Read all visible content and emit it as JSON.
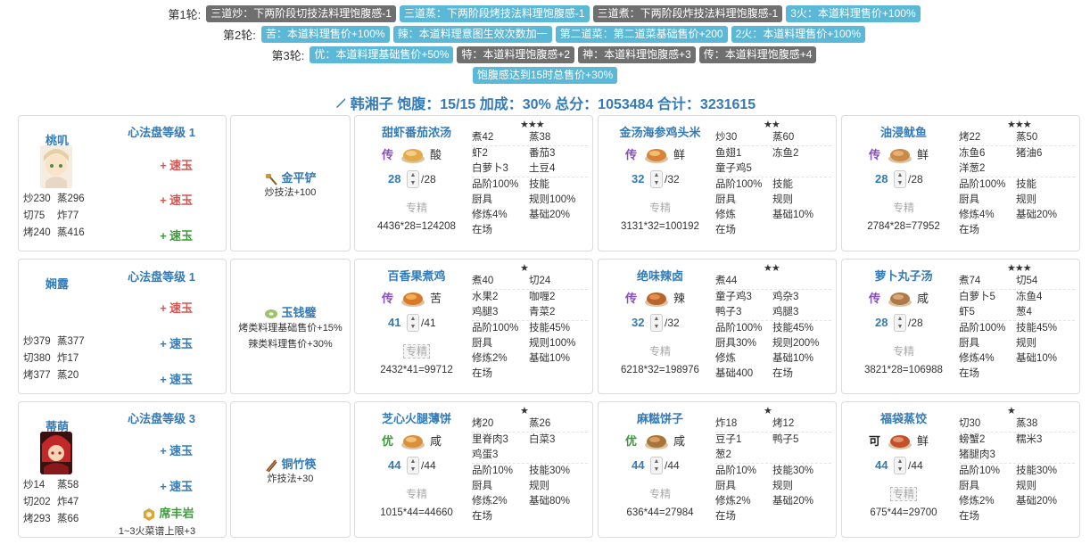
{
  "rounds": [
    {
      "label": "第1轮:",
      "tags": [
        {
          "text": "三道炒：下两阶段切技法料理饱腹感-1",
          "color": "gray"
        },
        {
          "text": "三道蒸：下两阶段烤技法料理饱腹感-1",
          "color": "blue"
        },
        {
          "text": "三道煮：下两阶段炸技法料理饱腹感-1",
          "color": "gray"
        },
        {
          "text": "3火：本道料理售价+100%",
          "color": "blue"
        }
      ]
    },
    {
      "label": "第2轮:",
      "tags": [
        {
          "text": "苦：本道料理售价+100%",
          "color": "blue"
        },
        {
          "text": "辣：本道料理意图生效次数加一",
          "color": "blue"
        },
        {
          "text": "第二道菜：第二道菜基础售价+200",
          "color": "blue"
        },
        {
          "text": "2火：本道料理售价+100%",
          "color": "blue"
        }
      ]
    },
    {
      "label": "第3轮:",
      "tags": [
        {
          "text": "优：本道料理基础售价+50%",
          "color": "blue"
        },
        {
          "text": "特：本道料理饱腹感+2",
          "color": "gray"
        },
        {
          "text": "神：本道料理饱腹感+3",
          "color": "gray"
        },
        {
          "text": "传：本道料理饱腹感+4",
          "color": "gray"
        }
      ]
    },
    {
      "label": "",
      "tags": [
        {
          "text": "饱腹感达到15时总售价+30%",
          "color": "blue"
        }
      ]
    }
  ],
  "summary": {
    "icon": "knife-icon",
    "text": "韩湘子 饱腹：15/15 加成：30% 总分：1053484 合计：3231615"
  },
  "chefs": [
    {
      "name": "桃叽",
      "level": "心法盘等级 1",
      "stats": [
        [
          "炒230",
          "蒸296"
        ],
        [
          "切75",
          "炸77"
        ],
        [
          "烤240",
          "蒸416"
        ]
      ],
      "jades": [
        {
          "sign": "+",
          "text": "速玉",
          "color": "red"
        },
        {
          "sign": "+",
          "text": "速玉",
          "color": "red"
        },
        {
          "sign": "+",
          "text": "速玉",
          "color": "green"
        }
      ]
    },
    {
      "name": "娴露",
      "level": "心法盘等级 1",
      "stats": [
        [
          "炒379",
          "蒸377"
        ],
        [
          "切380",
          "炸17"
        ],
        [
          "烤377",
          "蒸20"
        ]
      ],
      "jades": [
        {
          "sign": "+",
          "text": "速玉",
          "color": "red"
        },
        {
          "sign": "+",
          "text": "速玉",
          "color": "blue"
        },
        {
          "sign": "+",
          "text": "速玉",
          "color": "blue"
        }
      ]
    },
    {
      "name": "蒂萌",
      "level": "心法盘等级 3",
      "stats": [
        [
          "炒14",
          "蒸58"
        ],
        [
          "切202",
          "炸47"
        ],
        [
          "烤293",
          "蒸66"
        ]
      ],
      "jades": [
        {
          "sign": "+",
          "text": "速玉",
          "color": "blue"
        },
        {
          "sign": "+",
          "text": "速玉",
          "color": "blue"
        }
      ],
      "aide": "席丰岩",
      "aide_note": "1~3火菜谱上限+3"
    }
  ],
  "equips": [
    {
      "name": "金平铲",
      "effects": [
        "炒技法+100"
      ]
    },
    {
      "name": "玉钱璧",
      "effects": [
        "烤类料理基础售价+15%",
        "辣类料理售价+30%"
      ]
    },
    {
      "name": "铜竹筷",
      "effects": [
        "炸技法+30"
      ]
    }
  ],
  "recipes": [
    [
      {
        "name": "甜虾番茄浓汤",
        "stars": "★★★",
        "rank": "传",
        "rank_color": "purple",
        "flavor": "酸",
        "qty": "28",
        "max": "/28",
        "skill": "专精",
        "skill_boxed": false,
        "total": "4436*28=124208",
        "rows": [
          [
            "煮42",
            "蒸38"
          ],
          [
            "虾2",
            "番茄3"
          ],
          [
            "白萝卜3",
            "土豆4"
          ],
          [
            "品阶100%",
            "技能"
          ],
          [
            "厨具",
            "规则100%"
          ],
          [
            "修炼4%",
            "基础20%"
          ],
          [
            "在场",
            ""
          ]
        ]
      },
      {
        "name": "金汤海参鸡头米",
        "stars": "★★",
        "rank": "传",
        "rank_color": "purple",
        "flavor": "鲜",
        "qty": "32",
        "max": "/32",
        "skill": "专精",
        "skill_boxed": false,
        "total": "3131*32=100192",
        "rows": [
          [
            "炒30",
            "蒸60"
          ],
          [
            "鱼翅1",
            "冻鱼2"
          ],
          [
            "童子鸡5",
            ""
          ],
          [
            "品阶100%",
            "技能"
          ],
          [
            "厨具",
            "规则"
          ],
          [
            "修炼",
            "基础10%"
          ],
          [
            "在场",
            ""
          ]
        ]
      },
      {
        "name": "油浸鱿鱼",
        "stars": "★★★",
        "rank": "传",
        "rank_color": "purple",
        "flavor": "鲜",
        "qty": "28",
        "max": "/28",
        "skill": "专精",
        "skill_boxed": false,
        "total": "2784*28=77952",
        "rows": [
          [
            "烤22",
            "蒸50"
          ],
          [
            "冻鱼6",
            "猪油6"
          ],
          [
            "洋葱2",
            ""
          ],
          [
            "品阶100%",
            "技能"
          ],
          [
            "厨具",
            "规则"
          ],
          [
            "修炼4%",
            "基础20%"
          ],
          [
            "在场",
            ""
          ]
        ]
      }
    ],
    [
      {
        "name": "百香果煮鸡",
        "stars": "★",
        "rank": "传",
        "rank_color": "purple",
        "flavor": "苦",
        "qty": "41",
        "max": "/41",
        "skill": "专精",
        "skill_boxed": true,
        "total": "2432*41=99712",
        "rows": [
          [
            "煮40",
            "切24"
          ],
          [
            "水果2",
            "咖喱2"
          ],
          [
            "鸡腿3",
            "青菜2"
          ],
          [
            "品阶100%",
            "技能45%"
          ],
          [
            "厨具",
            "规则100%"
          ],
          [
            "修炼2%",
            "基础10%"
          ],
          [
            "在场",
            ""
          ]
        ]
      },
      {
        "name": "绝味辣卤",
        "stars": "★★",
        "rank": "传",
        "rank_color": "purple",
        "flavor": "辣",
        "qty": "32",
        "max": "/32",
        "skill": "专精",
        "skill_boxed": false,
        "total": "6218*32=198976",
        "rows": [
          [
            "煮44",
            ""
          ],
          [
            "童子鸡3",
            "鸡杂3"
          ],
          [
            "鸭子3",
            "鸡腿3"
          ],
          [
            "品阶100%",
            "技能45%"
          ],
          [
            "厨具30%",
            "规则200%"
          ],
          [
            "修炼",
            "基础10%"
          ],
          [
            "基础400",
            "在场"
          ]
        ]
      },
      {
        "name": "萝卜丸子汤",
        "stars": "★★★",
        "rank": "传",
        "rank_color": "purple",
        "flavor": "咸",
        "qty": "28",
        "max": "/28",
        "skill": "专精",
        "skill_boxed": false,
        "total": "3821*28=106988",
        "rows": [
          [
            "煮74",
            "切54"
          ],
          [
            "白萝卜5",
            "冻鱼4"
          ],
          [
            "虾5",
            "葱4"
          ],
          [
            "品阶100%",
            "技能45%"
          ],
          [
            "厨具",
            "规则"
          ],
          [
            "修炼4%",
            "基础10%"
          ],
          [
            "在场",
            ""
          ]
        ]
      }
    ],
    [
      {
        "name": "芝心火腿薄饼",
        "stars": "★",
        "rank": "优",
        "rank_color": "green",
        "flavor": "咸",
        "qty": "44",
        "max": "/44",
        "skill": "专精",
        "skill_boxed": false,
        "total": "1015*44=44660",
        "rows": [
          [
            "烤20",
            "蒸26"
          ],
          [
            "里脊肉3",
            "白菜3"
          ],
          [
            "鸡蛋3",
            ""
          ],
          [
            "品阶10%",
            "技能30%"
          ],
          [
            "厨具",
            "规则"
          ],
          [
            "修炼2%",
            "基础80%"
          ],
          [
            "在场",
            ""
          ]
        ]
      },
      {
        "name": "麻糍饼子",
        "stars": "★",
        "rank": "优",
        "rank_color": "green",
        "flavor": "咸",
        "qty": "44",
        "max": "/44",
        "skill": "专精",
        "skill_boxed": false,
        "total": "636*44=27984",
        "rows": [
          [
            "炸18",
            "烤12"
          ],
          [
            "豆子1",
            "鸭子5"
          ],
          [
            "葱2",
            ""
          ],
          [
            "品阶10%",
            "技能30%"
          ],
          [
            "厨具",
            "规则"
          ],
          [
            "修炼2%",
            "基础20%"
          ],
          [
            "在场",
            ""
          ]
        ]
      },
      {
        "name": "福袋蒸饺",
        "stars": "★",
        "rank": "可",
        "rank_color": "black",
        "flavor": "鲜",
        "qty": "44",
        "max": "/44",
        "skill": "专精",
        "skill_boxed": true,
        "total": "675*44=29700",
        "rows": [
          [
            "切30",
            "蒸38"
          ],
          [
            "螃蟹2",
            "糯米3"
          ],
          [
            "猪腿肉3",
            ""
          ],
          [
            "品阶10%",
            "技能30%"
          ],
          [
            "厨具",
            "规则"
          ],
          [
            "修炼2%",
            "基础20%"
          ],
          [
            "在场",
            ""
          ]
        ]
      }
    ]
  ]
}
